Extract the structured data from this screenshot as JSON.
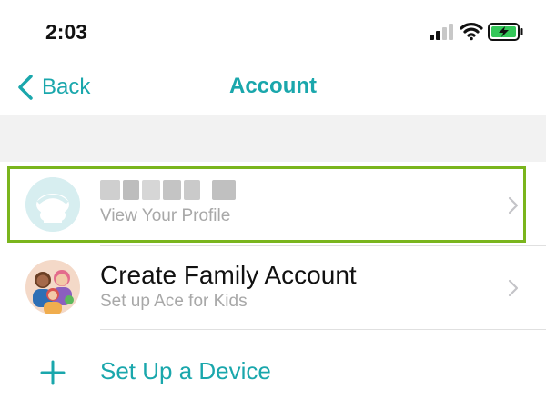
{
  "status_bar": {
    "time": "2:03",
    "icons": [
      "signal-icon",
      "wifi-icon",
      "battery-charging-icon"
    ],
    "battery_color": "#34c759"
  },
  "nav": {
    "back_label": "Back",
    "title": "Account",
    "accent_color": "#1aa7ac"
  },
  "list": {
    "profile": {
      "name": "",
      "subtitle": "View Your Profile",
      "highlight_color": "#7ab51d"
    },
    "family": {
      "title": "Create Family Account",
      "subtitle": "Set up Ace for Kids"
    },
    "device": {
      "label": "Set Up a Device"
    }
  }
}
